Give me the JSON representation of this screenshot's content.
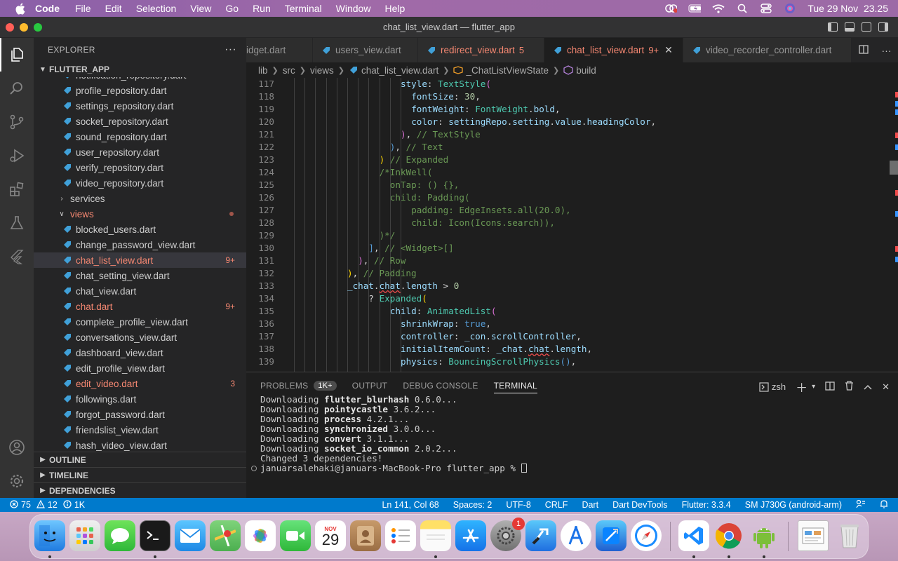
{
  "menubar": {
    "app": "Code",
    "items": [
      "File",
      "Edit",
      "Selection",
      "View",
      "Go",
      "Run",
      "Terminal",
      "Window",
      "Help"
    ],
    "clock": "Tue 29 Nov  23.25"
  },
  "window": {
    "title": "chat_list_view.dart — flutter_app"
  },
  "sidebar": {
    "header": "EXPLORER",
    "root": "FLUTTER_APP",
    "files": [
      {
        "name": "notification_repository.dart",
        "indent": 2,
        "type": "file"
      },
      {
        "name": "profile_repository.dart",
        "indent": 2,
        "type": "file"
      },
      {
        "name": "settings_repository.dart",
        "indent": 2,
        "type": "file"
      },
      {
        "name": "socket_repository.dart",
        "indent": 2,
        "type": "file"
      },
      {
        "name": "sound_repository.dart",
        "indent": 2,
        "type": "file"
      },
      {
        "name": "user_repository.dart",
        "indent": 2,
        "type": "file"
      },
      {
        "name": "verify_repository.dart",
        "indent": 2,
        "type": "file"
      },
      {
        "name": "video_repository.dart",
        "indent": 2,
        "type": "file"
      },
      {
        "name": "services",
        "indent": 1,
        "type": "folder-closed"
      },
      {
        "name": "views",
        "indent": 1,
        "type": "folder-open",
        "status": "err"
      },
      {
        "name": "blocked_users.dart",
        "indent": 2,
        "type": "file"
      },
      {
        "name": "change_password_view.dart",
        "indent": 2,
        "type": "file"
      },
      {
        "name": "chat_list_view.dart",
        "indent": 2,
        "type": "file",
        "status": "err",
        "badge": "9+",
        "selected": true
      },
      {
        "name": "chat_setting_view.dart",
        "indent": 2,
        "type": "file"
      },
      {
        "name": "chat_view.dart",
        "indent": 2,
        "type": "file"
      },
      {
        "name": "chat.dart",
        "indent": 2,
        "type": "file",
        "status": "err",
        "badge": "9+"
      },
      {
        "name": "complete_profile_view.dart",
        "indent": 2,
        "type": "file"
      },
      {
        "name": "conversations_view.dart",
        "indent": 2,
        "type": "file"
      },
      {
        "name": "dashboard_view.dart",
        "indent": 2,
        "type": "file"
      },
      {
        "name": "edit_profile_view.dart",
        "indent": 2,
        "type": "file"
      },
      {
        "name": "edit_video.dart",
        "indent": 2,
        "type": "file",
        "status": "err",
        "badge": "3"
      },
      {
        "name": "followings.dart",
        "indent": 2,
        "type": "file"
      },
      {
        "name": "forgot_password.dart",
        "indent": 2,
        "type": "file"
      },
      {
        "name": "friendslist_view.dart",
        "indent": 2,
        "type": "file"
      },
      {
        "name": "hash_video_view.dart",
        "indent": 2,
        "type": "file"
      }
    ],
    "sections": [
      "OUTLINE",
      "TIMELINE",
      "DEPENDENCIES"
    ]
  },
  "tabs": [
    {
      "label": "idget.dart",
      "status": "normal"
    },
    {
      "label": "users_view.dart",
      "status": "normal"
    },
    {
      "label": "redirect_view.dart",
      "status": "err",
      "badge": "5"
    },
    {
      "label": "chat_list_view.dart",
      "status": "active",
      "badge": "9+"
    },
    {
      "label": "video_recorder_controller.dart",
      "status": "normal"
    }
  ],
  "breadcrumb": [
    "lib",
    "src",
    "views",
    "chat_list_view.dart",
    "_ChatListViewState",
    "build"
  ],
  "editor": {
    "lines": [
      {
        "n": "117",
        "ind": 20,
        "html": "<span class='k'>style</span><span class='p'>: </span><span class='t'>TextStyle</span><span class='m'>(</span>"
      },
      {
        "n": "118",
        "ind": 22,
        "html": "<span class='k'>fontSize</span><span class='p'>: </span><span class='n'>30</span><span class='p'>,</span>"
      },
      {
        "n": "119",
        "ind": 22,
        "html": "<span class='k'>fontWeight</span><span class='p'>: </span><span class='t'>FontWeight</span><span class='p'>.</span><span class='k'>bold</span><span class='p'>,</span>"
      },
      {
        "n": "120",
        "ind": 22,
        "html": "<span class='k'>color</span><span class='p'>: </span><span class='k'>settingRepo</span><span class='p'>.</span><span class='k'>setting</span><span class='p'>.</span><span class='k'>value</span><span class='p'>.</span><span class='k'>headingColor</span><span class='p'>,</span>"
      },
      {
        "n": "121",
        "ind": 20,
        "html": "<span class='m'>)</span><span class='p'>, </span><span class='c'>// TextStyle</span>"
      },
      {
        "n": "122",
        "ind": 18,
        "html": "<span class='b'>)</span><span class='p'>, </span><span class='c'>// Text</span>"
      },
      {
        "n": "123",
        "ind": 16,
        "html": "<span class='y'>)</span><span class='p'> </span><span class='c'>// Expanded</span>"
      },
      {
        "n": "124",
        "ind": 16,
        "html": "<span class='c'>/*InkWell(</span>"
      },
      {
        "n": "125",
        "ind": 18,
        "html": "<span class='c'>onTap: () {},</span>"
      },
      {
        "n": "126",
        "ind": 18,
        "html": "<span class='c'>child: Padding(</span>"
      },
      {
        "n": "127",
        "ind": 22,
        "html": "<span class='c'>padding: EdgeInsets.all(20.0),</span>"
      },
      {
        "n": "128",
        "ind": 22,
        "html": "<span class='c'>child: Icon(Icons.search)),</span>"
      },
      {
        "n": "129",
        "ind": 16,
        "html": "<span class='c'>)*/</span>"
      },
      {
        "n": "130",
        "ind": 14,
        "html": "<span class='b'>]</span><span class='p'>, </span><span class='c'>// &lt;Widget&gt;[]</span>"
      },
      {
        "n": "131",
        "ind": 12,
        "html": "<span class='m'>)</span><span class='p'>, </span><span class='c'>// Row</span>"
      },
      {
        "n": "132",
        "ind": 10,
        "html": "<span class='y'>)</span><span class='p'>, </span><span class='c'>// Padding</span>"
      },
      {
        "n": "133",
        "ind": 10,
        "html": "<span class='k'>_chat</span><span class='p'>.</span><span class='k sq'>chat</span><span class='p'>.</span><span class='k'>length</span><span class='p'> &gt; </span><span class='n'>0</span>"
      },
      {
        "n": "134",
        "ind": 14,
        "html": "<span class='p'>? </span><span class='t'>Expanded</span><span class='y'>(</span>"
      },
      {
        "n": "135",
        "ind": 18,
        "html": "<span class='k'>child</span><span class='p'>: </span><span class='t'>AnimatedList</span><span class='m'>(</span>"
      },
      {
        "n": "136",
        "ind": 20,
        "html": "<span class='k'>shrinkWrap</span><span class='p'>: </span><span class='b'>true</span><span class='p'>,</span>"
      },
      {
        "n": "137",
        "ind": 20,
        "html": "<span class='k'>controller</span><span class='p'>: </span><span class='k'>_con</span><span class='p'>.</span><span class='k'>scrollController</span><span class='p'>,</span>"
      },
      {
        "n": "138",
        "ind": 20,
        "html": "<span class='k'>initialItemCount</span><span class='p'>: </span><span class='k'>_chat</span><span class='p'>.</span><span class='k sq'>chat</span><span class='p'>.</span><span class='k'>length</span><span class='p'>,</span>"
      },
      {
        "n": "139",
        "ind": 20,
        "html": "<span class='k'>physics</span><span class='p'>: </span><span class='t'>BouncingScrollPhysics</span><span class='b'>()</span><span class='p'>,</span>"
      }
    ]
  },
  "panel": {
    "tabs": [
      {
        "label": "PROBLEMS",
        "badge": "1K+"
      },
      {
        "label": "OUTPUT"
      },
      {
        "label": "DEBUG CONSOLE"
      },
      {
        "label": "TERMINAL",
        "active": true
      }
    ],
    "shell": "zsh",
    "terminal": [
      {
        "pre": "Downloading ",
        "pkg": "flutter_blurhash",
        "ver": " 0.6.0..."
      },
      {
        "pre": "Downloading ",
        "pkg": "pointycastle",
        "ver": " 3.6.2..."
      },
      {
        "pre": "Downloading ",
        "pkg": "process",
        "ver": " 4.2.1..."
      },
      {
        "pre": "Downloading ",
        "pkg": "synchronized",
        "ver": " 3.0.0..."
      },
      {
        "pre": "Downloading ",
        "pkg": "convert",
        "ver": " 3.1.1..."
      },
      {
        "pre": "Downloading ",
        "pkg": "socket_io_common",
        "ver": " 2.0.2..."
      },
      {
        "pre": "Changed 3 dependencies!",
        "pkg": "",
        "ver": ""
      }
    ],
    "prompt": "januarsalehaki@januars-MacBook-Pro flutter_app % "
  },
  "statusbar": {
    "errors": "75",
    "warnings": "12",
    "info": "1K",
    "right": [
      "Ln 141, Col 68",
      "Spaces: 2",
      "UTF-8",
      "CRLF",
      "Dart",
      "Dart DevTools",
      "Flutter: 3.3.4",
      "SM J730G (android-arm)"
    ]
  },
  "dock": {
    "calendar_month": "NOV",
    "calendar_day": "29",
    "settings_badge": "1"
  }
}
